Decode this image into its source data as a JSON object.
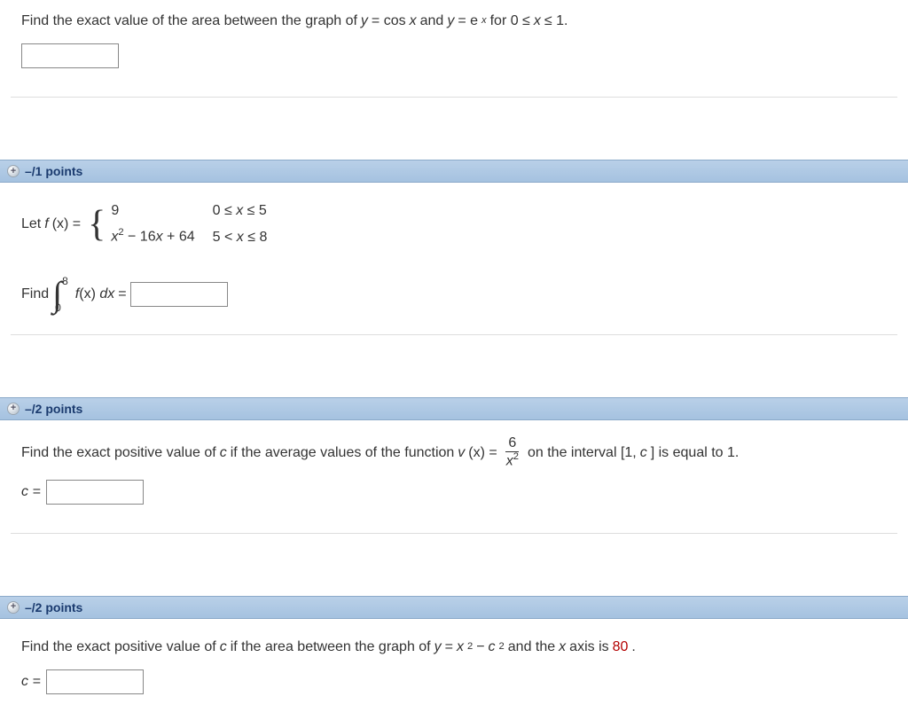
{
  "q1": {
    "prompt_pre": "Find the exact value of the area between the graph of ",
    "expr1_pre": "y",
    "expr1_mid": " = cos",
    "expr1_var": "x",
    "and": " and ",
    "expr2_pre": "y",
    "expr2_mid": " = e",
    "expr2_exp": "x",
    "for": " for 0 ≤ ",
    "xvar": "x",
    "interval_end": " ≤ 1."
  },
  "q2": {
    "points": "–/1 points",
    "let": "Let  ",
    "fx": "f",
    "paren": "(x) = ",
    "row1_left": "9",
    "row1_right_a": "0 ≤ ",
    "row1_right_b": "x",
    "row1_right_c": " ≤ 5",
    "row2_left_a": "x",
    "row2_left_b": " − 16",
    "row2_left_c": "x",
    "row2_left_d": " + 64",
    "row2_right_a": "5 < ",
    "row2_right_b": "x",
    "row2_right_c": " ≤ 8",
    "find": "Find",
    "upper": "8",
    "lower": "0",
    "integrand_a": "f",
    "integrand_b": "(x) ",
    "dx": "dx",
    "equals": "  =  "
  },
  "q3": {
    "points": "–/2 points",
    "prompt_a": "Find the exact positive value of ",
    "c1": "c",
    "prompt_b": " if the average values of the function  ",
    "v": "v",
    "vx": "(x) = ",
    "num": "6",
    "den_a": "x",
    "den_exp": "2",
    "prompt_c": " on the interval [1, ",
    "c2": "c",
    "prompt_d": "] is equal to 1.",
    "c_eq": "c ="
  },
  "q4": {
    "points": "–/2 points",
    "prompt_a": "Find the exact positive value of ",
    "c1": "c",
    "prompt_b": " if the area between the graph of ",
    "y": "y",
    "eq": " = ",
    "x": "x",
    "exp2a": "2",
    "minus": " − ",
    "c": "c",
    "exp2b": "2",
    "prompt_c": " and the ",
    "xaxis": "x",
    "prompt_d": " axis is ",
    "eighty": "80",
    "period": ".",
    "c_eq": "c ="
  }
}
